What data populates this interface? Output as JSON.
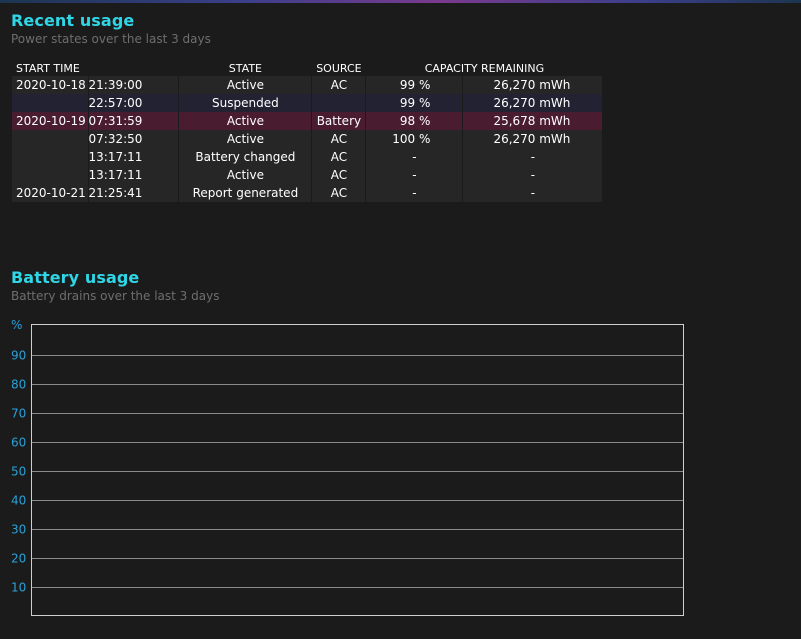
{
  "recent": {
    "title": "Recent usage",
    "subtitle": "Power states over the last 3 days",
    "headers": {
      "start_time": "START TIME",
      "state": "STATE",
      "source": "SOURCE",
      "capacity": "CAPACITY REMAINING"
    },
    "rows": [
      {
        "date": "2020-10-18",
        "time": "21:39:00",
        "state": "Active",
        "source": "AC",
        "pct": "99 %",
        "mwh": "26,270 mWh"
      },
      {
        "date": "",
        "time": "22:57:00",
        "state": "Suspended",
        "source": "",
        "pct": "99 %",
        "mwh": "26,270 mWh"
      },
      {
        "date": "2020-10-19",
        "time": "07:31:59",
        "state": "Active",
        "source": "Battery",
        "pct": "98 %",
        "mwh": "25,678 mWh"
      },
      {
        "date": "",
        "time": "07:32:50",
        "state": "Active",
        "source": "AC",
        "pct": "100 %",
        "mwh": "26,270 mWh"
      },
      {
        "date": "",
        "time": "13:17:11",
        "state": "Battery changed",
        "source": "AC",
        "pct": "-",
        "mwh": "-"
      },
      {
        "date": "",
        "time": "13:17:11",
        "state": "Active",
        "source": "AC",
        "pct": "-",
        "mwh": "-"
      },
      {
        "date": "2020-10-21",
        "time": "21:25:41",
        "state": "Report generated",
        "source": "AC",
        "pct": "-",
        "mwh": "-"
      }
    ]
  },
  "battery": {
    "title": "Battery usage",
    "subtitle": "Battery drains over the last 3 days"
  },
  "chart_data": {
    "type": "area",
    "title": "",
    "ylabel": "%",
    "ylim": [
      0,
      100
    ],
    "yticks": [
      "90",
      "80",
      "70",
      "60",
      "50",
      "40",
      "30",
      "20",
      "10"
    ],
    "grid": true,
    "series": []
  },
  "colors": {
    "accent": "#2fd6e6",
    "axis_label": "#2aa0d8",
    "battery_row": "#4a1c30",
    "suspended_row": "#222233"
  }
}
